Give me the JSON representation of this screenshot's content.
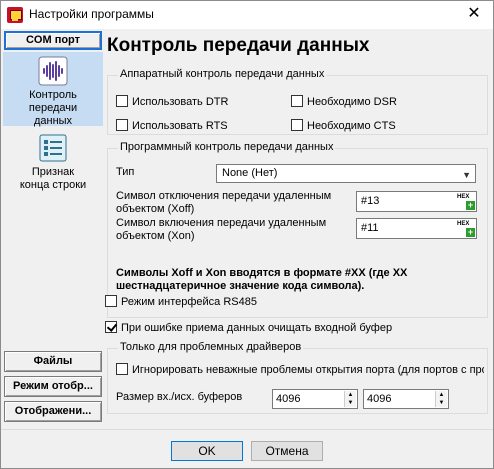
{
  "window": {
    "title": "Настройки программы",
    "close_glyph": "✕",
    "icon": "app-icon"
  },
  "sidebar": {
    "header_button": "COM порт",
    "items": [
      {
        "label": "Контроль передачи данных",
        "icon": "waveform-icon",
        "selected": true
      },
      {
        "label": "Признак конца строки",
        "icon": "list-icon",
        "selected": false
      }
    ],
    "bottom_buttons": [
      "Файлы",
      "Режим отобр...",
      "Отображени..."
    ]
  },
  "main": {
    "title": "Контроль передачи данных",
    "hardware": {
      "title": "Аппаратный контроль передачи данных",
      "use_dtr": "Использовать DTR",
      "need_dsr": "Необходимо DSR",
      "use_rts": "Использовать RTS",
      "need_cts": "Необходимо CTS"
    },
    "software": {
      "title": "Программный контроль передачи данных",
      "type_label": "Тип",
      "type_value": "None (Нет)",
      "xoff_label": "Символ отключения передачи удаленным объектом (Xoff)",
      "xoff_value": "#13",
      "xon_label": "Символ включения передачи удаленным объектом (Xon)",
      "xon_value": "#11",
      "hex_label": "HEX",
      "plus": "+",
      "note": "Символы Xoff и Xon вводятся в формате #XX (где XX шестнадцатеричное значение кода символа)."
    },
    "rs485": {
      "label": "Режим интерфейса RS485",
      "checked": false
    },
    "clear_buffer": {
      "label": "При ошибке приема данных очищать входной буфер",
      "checked": true
    },
    "problem": {
      "title": "Только для проблемных драйверов",
      "ignore_label": "Игнорировать неважные проблемы открытия порта (для портов с проблемами)",
      "ignore_checked": false,
      "buffer_label": "Размер вх./исх. буферов",
      "in_buffer": "4096",
      "out_buffer": "4096"
    }
  },
  "footer": {
    "ok": "OK",
    "cancel": "Отмена"
  }
}
